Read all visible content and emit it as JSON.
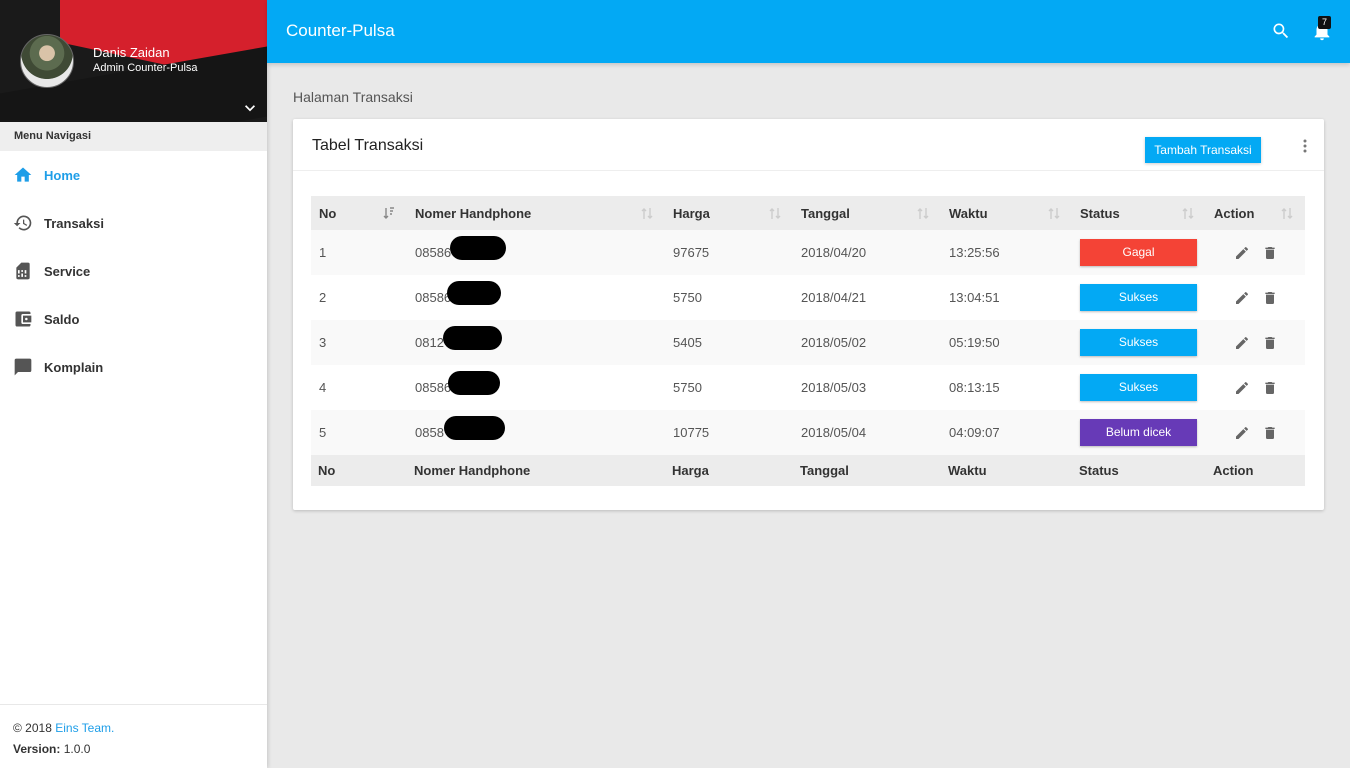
{
  "user": {
    "name": "Danis Zaidan",
    "role": "Admin Counter-Pulsa"
  },
  "sidebar": {
    "header": "Menu Navigasi",
    "items": [
      {
        "label": "Home",
        "icon": "home-icon",
        "active": true
      },
      {
        "label": "Transaksi",
        "icon": "history-icon"
      },
      {
        "label": "Service",
        "icon": "sim-card-icon"
      },
      {
        "label": "Saldo",
        "icon": "wallet-icon"
      },
      {
        "label": "Komplain",
        "icon": "chat-icon"
      }
    ],
    "footer": {
      "copyright_prefix": "© 2018 ",
      "team": "Eins Team.",
      "version_label": "Version:",
      "version_value": " 1.0.0"
    }
  },
  "topbar": {
    "title": "Counter-Pulsa",
    "notification_count": "7"
  },
  "page": {
    "breadcrumb": "Halaman Transaksi"
  },
  "card": {
    "title": "Tabel Transaksi",
    "add_button": "Tambah Transaksi"
  },
  "table": {
    "headers": [
      "No",
      "Nomer Handphone",
      "Harga",
      "Tanggal",
      "Waktu",
      "Status",
      "Action"
    ],
    "rows": [
      {
        "no": "1",
        "phone": "08586",
        "harga": "97675",
        "tanggal": "2018/04/20",
        "waktu": "13:25:56",
        "status": "Gagal"
      },
      {
        "no": "2",
        "phone": "08586",
        "harga": "5750",
        "tanggal": "2018/04/21",
        "waktu": "13:04:51",
        "status": "Sukses"
      },
      {
        "no": "3",
        "phone": "0812",
        "harga": "5405",
        "tanggal": "2018/05/02",
        "waktu": "05:19:50",
        "status": "Sukses"
      },
      {
        "no": "4",
        "phone": "08586",
        "harga": "5750",
        "tanggal": "2018/05/03",
        "waktu": "08:13:15",
        "status": "Sukses"
      },
      {
        "no": "5",
        "phone": "0858",
        "harga": "10775",
        "tanggal": "2018/05/04",
        "waktu": "04:09:07",
        "status": "Belum dicek"
      }
    ]
  },
  "colors": {
    "primary": "#03a9f4",
    "danger": "#f44336",
    "purple": "#673ab7",
    "accent_text": "#1e9ee8"
  }
}
